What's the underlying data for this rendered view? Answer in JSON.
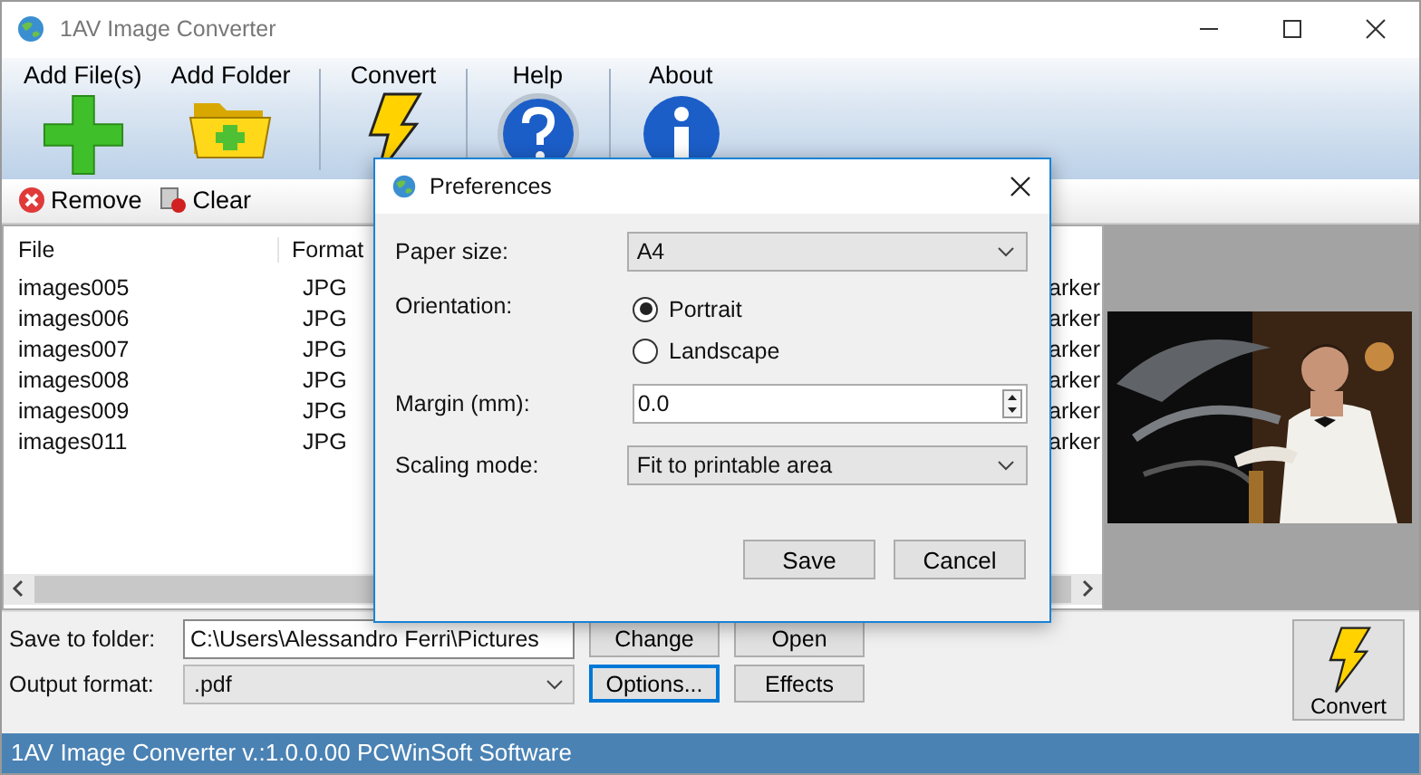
{
  "window": {
    "title": "1AV Image Converter"
  },
  "toolbar": [
    {
      "label": "Add File(s)",
      "kind": "add"
    },
    {
      "label": "Add Folder",
      "kind": "folder"
    },
    {
      "label": "Convert",
      "kind": "convert"
    },
    {
      "label": "Help",
      "kind": "help"
    },
    {
      "label": "About",
      "kind": "about"
    }
  ],
  "actions": [
    {
      "label": "Remove",
      "kind": "remove"
    },
    {
      "label": "Clear",
      "kind": "clear"
    }
  ],
  "file_list": {
    "columns": [
      "File",
      "Format"
    ],
    "rows": [
      {
        "file": "images005",
        "format": "JPG",
        "column_3": "arker"
      },
      {
        "file": "images006",
        "format": "JPG",
        "column_3": "arker"
      },
      {
        "file": "images007",
        "format": "JPG",
        "column_3": "arker"
      },
      {
        "file": "images008",
        "format": "JPG",
        "column_3": "arker"
      },
      {
        "file": "images009",
        "format": "JPG",
        "column_3": "arker"
      },
      {
        "file": "images011",
        "format": "JPG",
        "column_3": "arker"
      }
    ]
  },
  "bottom": {
    "save_label": "Save to folder:",
    "folder": "C:\\Users\\Alessandro Ferri\\Pictures",
    "output_label": "Output format:",
    "format": ".pdf",
    "buttons": [
      {
        "label": "Change",
        "focused": false
      },
      {
        "label": "Open",
        "focused": false
      },
      {
        "label": "Options...",
        "focused": true
      },
      {
        "label": "Effects",
        "focused": false
      }
    ],
    "convert_button": "Convert"
  },
  "status_bar": "1AV Image Converter v.:1.0.0.00 PCWinSoft Software",
  "dialog": {
    "title": "Preferences",
    "paper_size": {
      "label": "Paper size:",
      "value": "A4"
    },
    "orientation": {
      "label": "Orientation:",
      "options": [
        {
          "label": "Portrait",
          "selected": true
        },
        {
          "label": "Landscape",
          "selected": false
        }
      ]
    },
    "margin": {
      "label": "Margin (mm):",
      "value": "0.0"
    },
    "scaling": {
      "label": "Scaling mode:",
      "value": "Fit to printable area"
    },
    "buttons": [
      "Save",
      "Cancel"
    ]
  }
}
